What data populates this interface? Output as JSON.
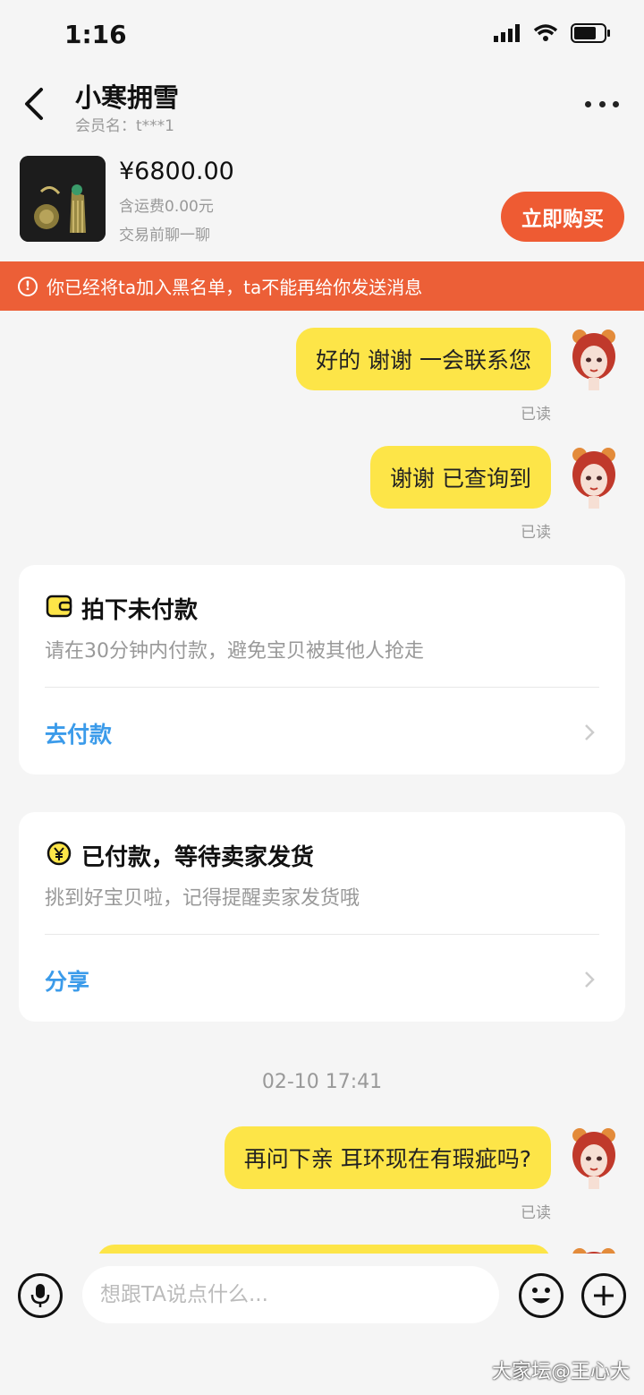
{
  "status_bar": {
    "time": "1:16"
  },
  "header": {
    "title": "小寒拥雪",
    "member_label": "会员名：t***1"
  },
  "product": {
    "price": "¥6800.00",
    "shipping": "含运费0.00元",
    "chat_hint": "交易前聊一聊",
    "buy_label": "立即购买"
  },
  "warning": {
    "text": "你已经将ta加入黑名单，ta不能再给你发送消息"
  },
  "messages": [
    {
      "text": "好的 谢谢 一会联系您",
      "status": "已读"
    },
    {
      "text": "谢谢 已查询到",
      "status": "已读"
    },
    {
      "text": "再问下亲 耳环现在有瑕疵吗?",
      "status": "已读"
    }
  ],
  "cards": [
    {
      "title": "拍下未付款",
      "desc": "请在30分钟内付款，避免宝贝被其他人抢走",
      "action": "去付款",
      "icon": "wallet-icon"
    },
    {
      "title": "已付款，等待卖家发货",
      "desc": "挑到好宝贝啦，记得提醒卖家发货哦",
      "action": "分享",
      "icon": "yen-coin-icon"
    }
  ],
  "timestamp": "02-10 17:41",
  "input": {
    "placeholder": "想跟TA说点什么..."
  },
  "watermark": "大家坛@王心大",
  "colors": {
    "accent": "#ee5b33",
    "bubble": "#fde548",
    "link": "#3b9bea"
  }
}
